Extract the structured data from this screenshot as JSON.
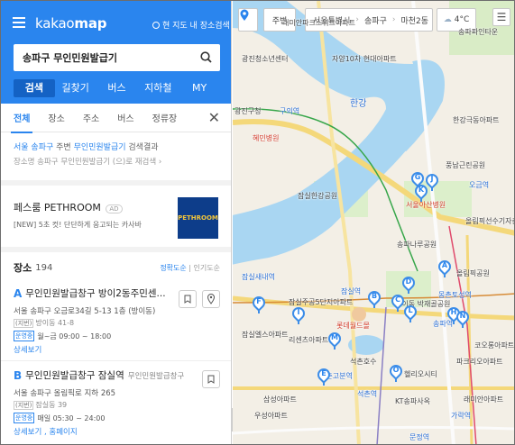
{
  "header": {
    "logo_light": "kakao",
    "logo_bold": "map",
    "map_search_toggle": "현 지도 내 장소검색",
    "search_value": "송파구 무인민원발급기",
    "tabs": [
      {
        "label": "검색",
        "active": true
      },
      {
        "label": "길찾기"
      },
      {
        "label": "버스"
      },
      {
        "label": "지하철"
      },
      {
        "label": "MY"
      }
    ]
  },
  "subtabs": [
    "전체",
    "장소",
    "주소",
    "버스",
    "정류장"
  ],
  "query_info": {
    "line1_a": "서울 송파구",
    "line1_b": " 주변 ",
    "line1_c": "무인민원발급기",
    "line1_d": " 검색결과",
    "line2": "장소명 송파구 무인민원발급기 (으)로 재검색 ›"
  },
  "ad": {
    "title": "페스룸 PETHROOM",
    "badge": "AD",
    "subtitle": "[NEW] 5초 컷! 단단하게 응고되는 카사바",
    "logo_text": "PETHROOM"
  },
  "places": {
    "label": "장소",
    "count": "194",
    "sort_accuracy": "정확도순",
    "sort_popular": "인기도순",
    "items": [
      {
        "marker": "A",
        "name": "무인민원발급창구 방이2동주민센...",
        "category": "",
        "address": "서울 송파구 오금로34길 5-13 1층 (방이동)",
        "jibun_tag": "(지번)",
        "jibun": "방이동 41-8",
        "hours_tag": "운영중",
        "hours": "월~금 09:00 ~ 18:00",
        "link1": "상세보기",
        "link2": ""
      },
      {
        "marker": "B",
        "name": "무인민원발급창구 잠실역",
        "category": "무인민원발급창구",
        "address": "서울 송파구 올림픽로 지하 265",
        "jibun_tag": "(지번)",
        "jibun": "잠실동 39",
        "hours_tag": "운영중",
        "hours": "매일 05:30 ~ 24:00",
        "link1": "상세보기",
        "link2": "홈페이지"
      }
    ]
  },
  "map": {
    "area_label": "주변",
    "breadcrumb": [
      "서울특별시",
      "송파구",
      "마천2동"
    ],
    "weather": "4°C",
    "labels": [
      "래미안파크스위트아파트",
      "자양10차 현대아파트",
      "광진청소년센터",
      "구의역",
      "광진구청",
      "혜민병원",
      "한강",
      "잠실한강공원",
      "송파나루공원",
      "잠실새내역",
      "잠실역",
      "잠실주공5단지아파트",
      "롯데월드몰",
      "석촌호수",
      "방이동 박재골공원",
      "송파역",
      "올림픽공원",
      "서울아산병원",
      "풍납근린공원",
      "한강극동아파트",
      "올림픽선수기자촌아파트",
      "가락역",
      "문정역",
      "잠실엘스아파트",
      "리센츠아파트",
      "헬리오시티",
      "석촌역",
      "몽촌토성역",
      "파크리오아파트",
      "석촌고분역",
      "삼성아파트",
      "코오롱아파트",
      "우성아파트",
      "래미안아파트",
      "송파파인타운",
      "KT송파사옥",
      "오금역"
    ],
    "pins": [
      "A",
      "B",
      "C",
      "D",
      "E",
      "F",
      "G",
      "H",
      "I",
      "J",
      "K",
      "L",
      "M",
      "N",
      "O"
    ]
  }
}
